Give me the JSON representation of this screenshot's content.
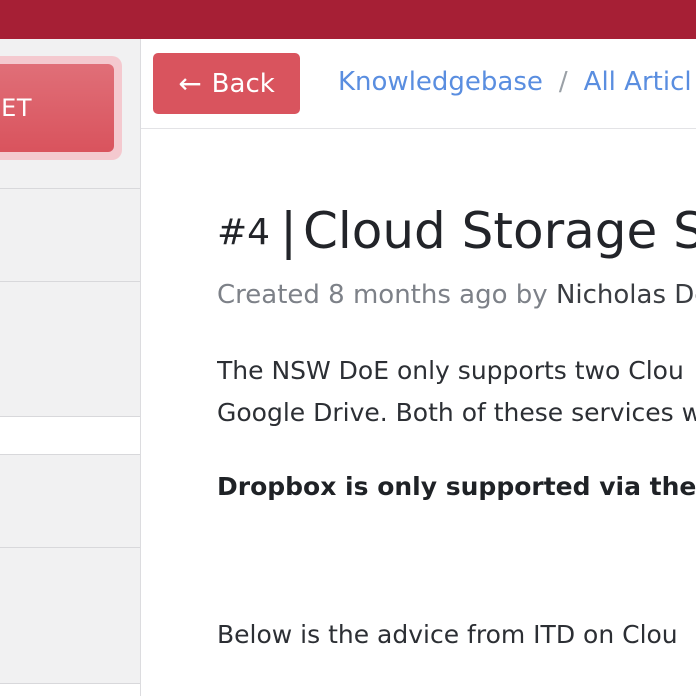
{
  "sidebar": {
    "ticket_button_label": "ET"
  },
  "header": {
    "back_label": "Back",
    "back_arrow": "←",
    "breadcrumb": {
      "item1": "Knowledgebase",
      "separator": "/",
      "item2": "All Articl"
    }
  },
  "article": {
    "number": "#4",
    "separator": "|",
    "title": "Cloud Storage S",
    "meta_prefix": "Created 8 months ago by ",
    "author": "Nicholas De",
    "para1_line1": "The NSW DoE only supports two Clou",
    "para1_line2": "Google Drive. Both of these services w",
    "bold_line": "Dropbox is only supported via the w",
    "para2": "Below is the advice from ITD on Clou"
  },
  "colors": {
    "topbar": "#a61f35",
    "accent_button": "#d9545e",
    "link": "#5a8ee0"
  }
}
